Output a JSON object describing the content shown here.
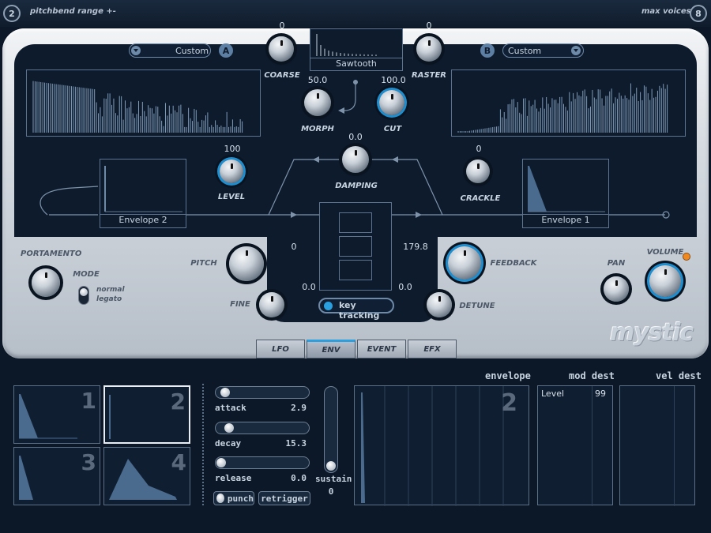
{
  "top": {
    "left_number": "2",
    "left_label": "pitchbend range +-",
    "right_label": "max voices",
    "right_number": "8"
  },
  "dropdown_a": {
    "value": "Custom",
    "badge": "A"
  },
  "dropdown_b": {
    "value": "Custom",
    "badge": "B"
  },
  "wave": {
    "name": "Sawtooth"
  },
  "knobs": {
    "coarse": {
      "label": "COARSE",
      "value": "0"
    },
    "raster": {
      "label": "RASTER",
      "value": "0"
    },
    "morph": {
      "label": "MORPH",
      "value": "50.0"
    },
    "cut": {
      "label": "CUT",
      "value": "100.0"
    },
    "damping": {
      "label": "DAMPING",
      "value": "0.0"
    },
    "level": {
      "label": "LEVEL",
      "value": "100"
    },
    "crackle": {
      "label": "CRACKLE",
      "value": "0"
    },
    "portamento": {
      "label": "PORTAMENTO"
    },
    "pitch": {
      "label": "PITCH",
      "value": "0"
    },
    "fine": {
      "label": "FINE",
      "value": "0.0"
    },
    "feedback": {
      "label": "FEEDBACK",
      "value": "179.8"
    },
    "detune": {
      "label": "DETUNE",
      "value": "0.0"
    },
    "pan": {
      "label": "PAN"
    },
    "volume": {
      "label": "VOLUME"
    }
  },
  "envelopes": {
    "left": "Envelope 2",
    "right": "Envelope 1"
  },
  "mode": {
    "label": "MODE",
    "option1": "normal",
    "option2": "legato"
  },
  "key_tracking": "key tracking",
  "brand": "mystic",
  "tabs": [
    "LFO",
    "ENV",
    "EVENT",
    "EFX"
  ],
  "env_slots": [
    "1",
    "2",
    "3",
    "4"
  ],
  "sliders": {
    "attack": {
      "label": "attack",
      "value": "2.9",
      "level": 0.05
    },
    "decay": {
      "label": "decay",
      "value": "15.3",
      "level": 0.1
    },
    "release": {
      "label": "release",
      "value": "0.0",
      "level": 0.0
    },
    "sustain": {
      "label": "sustain",
      "value": "0",
      "level": 0.0
    }
  },
  "buttons": {
    "punch": "punch",
    "retrigger": "retrigger"
  },
  "headers": {
    "envelope": "envelope",
    "mod_dest": "mod dest",
    "vel_dest": "vel dest"
  },
  "envelope_display_number": "2",
  "mod_dest": {
    "dest": "Level",
    "amount": "99"
  }
}
